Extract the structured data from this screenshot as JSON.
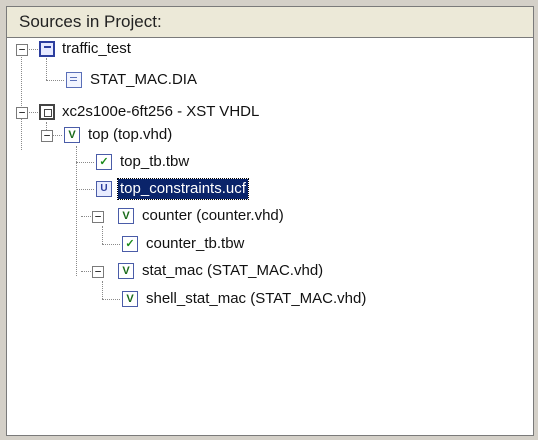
{
  "panel": {
    "title": "Sources in Project:"
  },
  "tree": {
    "project": "traffic_test",
    "project_file": "STAT_MAC.DIA",
    "device": "xc2s100e-6ft256 - XST VHDL",
    "top": "top (top.vhd)",
    "top_tb": "top_tb.tbw",
    "top_constraints": "top_constraints.ucf",
    "counter": "counter (counter.vhd)",
    "counter_tb": "counter_tb.tbw",
    "stat_mac": "stat_mac (STAT_MAC.vhd)",
    "shell_stat_mac": "shell_stat_mac (STAT_MAC.vhd)"
  },
  "icons": {
    "expand_collapsed": "−",
    "vhdl_mark": "V",
    "tbw_mark": "✓",
    "ucf_mark": "U"
  },
  "colors": {
    "selection": "#0a246a",
    "panel_bg": "#ffffff"
  }
}
